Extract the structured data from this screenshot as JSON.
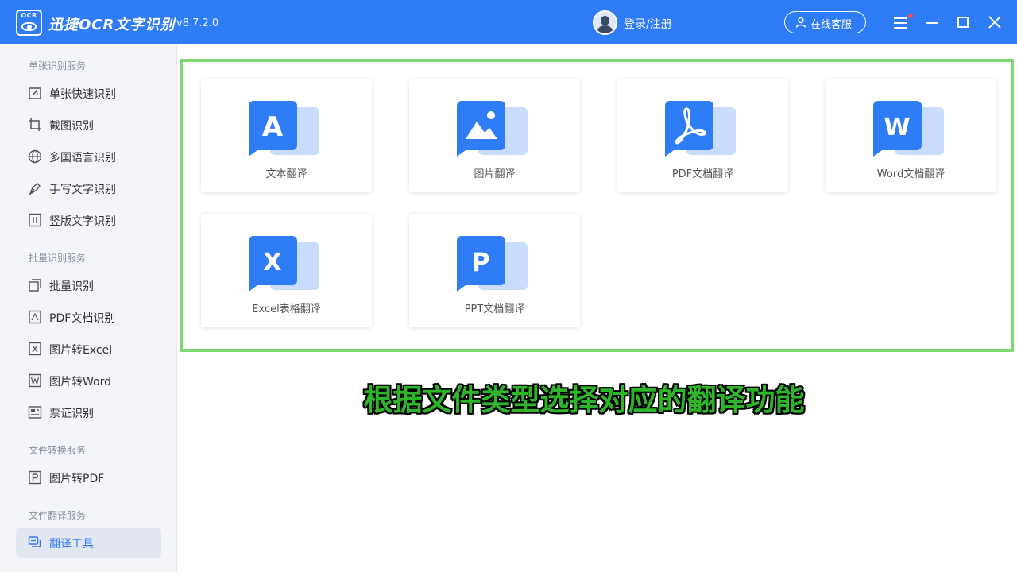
{
  "app": {
    "logo_text": "OCR",
    "name": "迅捷OCR文字识别",
    "version": "v8.7.2.0",
    "login": "登录/注册",
    "service": "在线客服"
  },
  "sidebar": {
    "groups": [
      {
        "title": "单张识别服务",
        "items": [
          {
            "label": "单张快速识别",
            "icon": "quick-scan-icon"
          },
          {
            "label": "截图识别",
            "icon": "crop-icon"
          },
          {
            "label": "多国语言识别",
            "icon": "globe-icon"
          },
          {
            "label": "手写文字识别",
            "icon": "pen-icon"
          },
          {
            "label": "竖版文字识别",
            "icon": "vertical-text-icon"
          }
        ]
      },
      {
        "title": "批量识别服务",
        "items": [
          {
            "label": "批量识别",
            "icon": "batch-icon"
          },
          {
            "label": "PDF文档识别",
            "icon": "pdf-icon"
          },
          {
            "label": "图片转Excel",
            "icon": "excel-icon"
          },
          {
            "label": "图片转Word",
            "icon": "word-icon"
          },
          {
            "label": "票证识别",
            "icon": "ticket-icon"
          }
        ]
      },
      {
        "title": "文件转换服务",
        "items": [
          {
            "label": "图片转PDF",
            "icon": "pdf-convert-icon"
          }
        ]
      },
      {
        "title": "文件翻译服务",
        "items": [
          {
            "label": "翻译工具",
            "icon": "translate-icon",
            "active": true
          }
        ]
      }
    ]
  },
  "tools": [
    {
      "label": "文本翻译",
      "glyph": "A",
      "icon": "text-translate-icon"
    },
    {
      "label": "图片翻译",
      "glyph": "",
      "icon": "image-translate-icon"
    },
    {
      "label": "PDF文档翻译",
      "glyph": "",
      "icon": "pdf-translate-icon"
    },
    {
      "label": "Word文档翻译",
      "glyph": "W",
      "icon": "word-translate-icon"
    },
    {
      "label": "Excel表格翻译",
      "glyph": "X",
      "icon": "excel-translate-icon"
    },
    {
      "label": "PPT文档翻译",
      "glyph": "P",
      "icon": "ppt-translate-icon"
    }
  ],
  "caption": "根据文件类型选择对应的翻译功能",
  "colors": {
    "brand": "#2e7cf6",
    "highlight": "#7ed973",
    "caption": "#2fb52a"
  }
}
